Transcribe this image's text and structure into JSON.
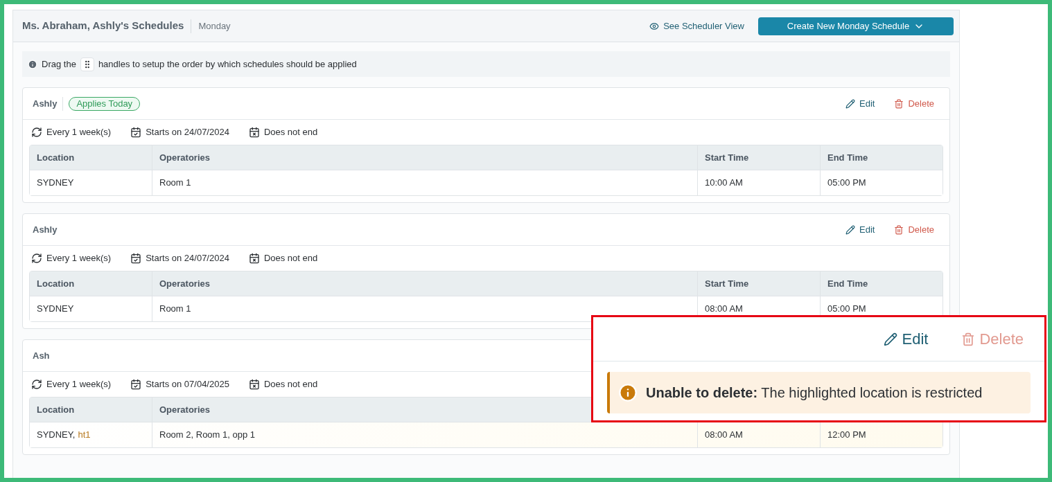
{
  "header": {
    "title": "Ms. Abraham, Ashly's Schedules",
    "day": "Monday",
    "scheduler_link": "See Scheduler View",
    "create_button": "Create New Monday Schedule"
  },
  "info": {
    "before": "Drag the",
    "after": "handles to setup the order by which schedules should be applied"
  },
  "schedules": [
    {
      "name": "Ashly",
      "badge": "Applies Today",
      "actions": {
        "edit": "Edit",
        "delete": "Delete",
        "delete_disabled": false
      },
      "recurrence": "Every 1 week(s)",
      "starts": "Starts on 24/07/2024",
      "ends": "Does not end",
      "columns": [
        "Location",
        "Operatories",
        "Start Time",
        "End Time"
      ],
      "rows": [
        {
          "highlighted": false,
          "location": [
            {
              "text": "SYDNEY",
              "restricted": false
            }
          ],
          "operatories": "Room 1",
          "start": "10:00 AM",
          "end": "05:00 PM"
        }
      ]
    },
    {
      "name": "Ashly",
      "actions": {
        "edit": "Edit",
        "delete": "Delete",
        "delete_disabled": false
      },
      "recurrence": "Every 1 week(s)",
      "starts": "Starts on 24/07/2024",
      "ends": "Does not end",
      "columns": [
        "Location",
        "Operatories",
        "Start Time",
        "End Time"
      ],
      "rows": [
        {
          "highlighted": false,
          "location": [
            {
              "text": "SYDNEY",
              "restricted": false
            }
          ],
          "operatories": "Room 1",
          "start": "08:00 AM",
          "end": "05:00 PM"
        }
      ]
    },
    {
      "name": "Ash",
      "recurrence": "Every 1 week(s)",
      "starts": "Starts on 07/04/2025",
      "ends": "Does not end",
      "columns": [
        "Location",
        "Operatories"
      ],
      "rows": [
        {
          "highlighted": true,
          "location": [
            {
              "text": "SYDNEY,",
              "restricted": false
            },
            {
              "text": "ht1",
              "restricted": true
            }
          ],
          "operatories": "Room 2, Room 1, opp 1",
          "start": "08:00 AM",
          "end": "12:00 PM"
        }
      ]
    }
  ],
  "callout": {
    "edit": "Edit",
    "delete": "Delete",
    "delete_disabled": true,
    "alert": "**Unable to delete:** The highlighted location is restricted"
  }
}
